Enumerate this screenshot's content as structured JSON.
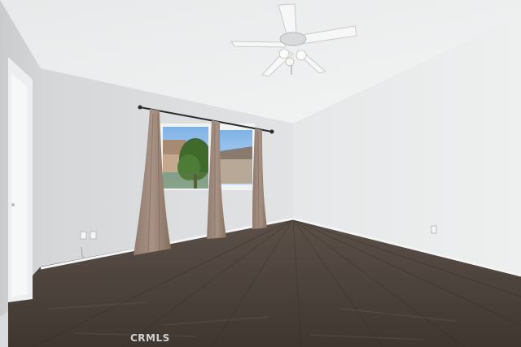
{
  "photo": {
    "watermark": "CRMLS"
  }
}
